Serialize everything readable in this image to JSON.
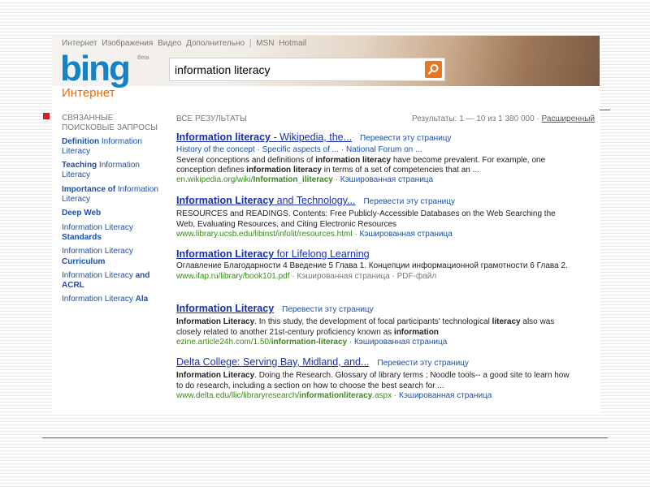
{
  "nav": [
    "Интернет",
    "Изображения",
    "Видео",
    "Дополнительно",
    "|",
    "MSN",
    "Hotmail"
  ],
  "logo": {
    "text": "bing",
    "beta": "Beta"
  },
  "search": {
    "query": "information literacy"
  },
  "vertical": "Интернет",
  "related": {
    "heading_1": "СВЯЗАННЫЕ",
    "heading_2": "ПОИСКОВЫЕ ЗАПРОСЫ",
    "items": [
      {
        "bold": "Definition",
        "rest": " Information Literacy"
      },
      {
        "bold": "Teaching",
        "rest": " Information Literacy"
      },
      {
        "bold": "Importance of",
        "rest": " Information Literacy"
      },
      {
        "bold": "Deep Web",
        "rest": ""
      },
      {
        "pre": "Information Literacy ",
        "bold": "Standards"
      },
      {
        "pre": "Information Literacy ",
        "bold": "Curriculum"
      },
      {
        "pre": "Information Literacy ",
        "bold": "and ACRL"
      },
      {
        "pre": "Information Literacy ",
        "bold": "Ala"
      }
    ]
  },
  "results_header": {
    "all": "ВСЕ РЕЗУЛЬТАТЫ",
    "count": "Результаты: 1 — 10 из 1 380 000 ·",
    "advanced": "Расширенный"
  },
  "results": [
    {
      "title_hl": "Information literacy",
      "title_rest": " - Wikipedia, the...",
      "translate": "Перевести эту страницу",
      "sub": "History of the concept · Specific aspects of ... · National Forum on ...",
      "snippet": "Several conceptions and definitions of <b>information literacy</b> have become prevalent. For example, one conception defines <b>information literacy</b> in terms of a set of competencies that an ...",
      "url": "en.wikipedia.org/wiki/<b>Information_iliteracy</b>",
      "cache": "Кэшированная страница"
    },
    {
      "title_hl": "Information Literacy",
      "title_rest": " and Technology...",
      "translate": "Перевести эту страницу",
      "sub": "",
      "snippet": "RESOURCES and READINGS. Contents: Free Publicly-Accessible Databases on the Web Searching the Web, Evaluating Resources, and Citing Electronic Resources",
      "url": "www.library.ucsb.edu/libinst/infolit/resources.html",
      "cache": "Кэшированная страница"
    },
    {
      "title_hl": "Information Literacy",
      "title_rest": " for Lifelong Learning",
      "translate": "",
      "sub": "",
      "snippet": "Оглавление Благодарности 4 Введение 5 Глава 1. Концепции информационной грамотности 6 Глава 2.",
      "url": "www.ifap.ru/library/book101.pdf",
      "cache": "Кэшированная страница · PDF-файл"
    },
    {
      "title_hl": "Information Literacy",
      "title_rest": "",
      "translate": "Перевести эту страницу",
      "sub": "",
      "snippet": "<b>Information Literacy</b>. In this study, the development of focal participants' technological <b>literacy</b> also was closely related to another 21st-century proficiency known as <b>information</b>",
      "url": "ezine.article24h.com/1.50/<b>information-literacy</b>",
      "cache": "Кэшированная страница"
    },
    {
      "title_hl": "",
      "title_rest": "Delta College: Serving Bay, Midland, and...",
      "translate": "Перевести эту страницу",
      "sub": "",
      "snippet": "<b>Information Literacy</b>. Doing the Research. Glossary of library terms ; Noodle tools-- a good site to learn how to do research, including a section on how to choose the best search for ...",
      "url": "www.delta.edu/llic/libraryresearch/<b>informationliteracy</b>.aspx",
      "cache": "Кэшированная страница"
    }
  ]
}
